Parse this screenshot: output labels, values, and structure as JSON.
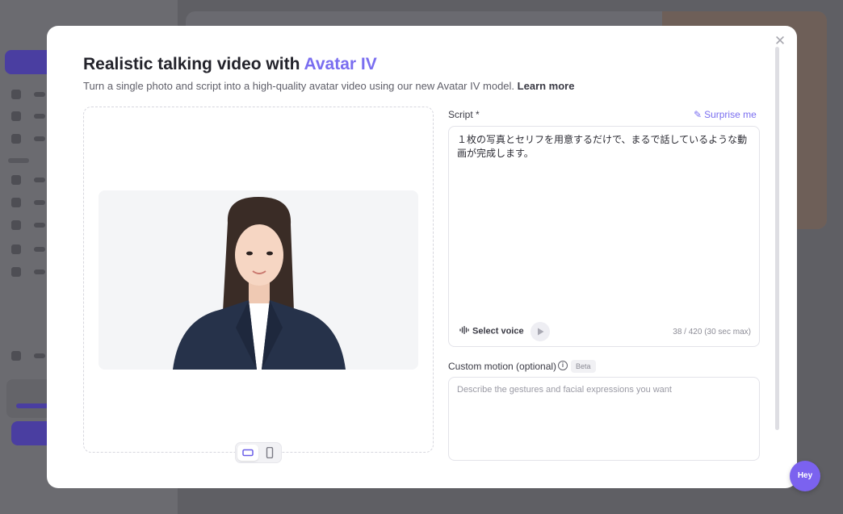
{
  "modal": {
    "title_prefix": "Realistic talking video with ",
    "title_accent": "Avatar IV",
    "subtitle": "Turn a single photo and script into a high-quality avatar video using our new Avatar IV model.",
    "learn_more": "Learn more",
    "close_icon": "close-icon"
  },
  "preview": {
    "photo_alt": "uploaded avatar photo",
    "orientation_selected": "landscape"
  },
  "script": {
    "label": "Script *",
    "surprise_label": "Surprise me",
    "text": "１枚の写真とセリフを用意するだけで、まるで話しているような動画が完成します。",
    "select_voice_label": "Select voice",
    "char_count": "38 / 420 (30 sec max)"
  },
  "motion": {
    "label": "Custom motion (optional)",
    "badge": "Beta",
    "placeholder": "Describe the gestures and facial expressions you want"
  },
  "help": {
    "label": "Hey"
  },
  "colors": {
    "accent": "#7a6ef0",
    "overlay": "#5f5f64",
    "help_button": "#7b62ef"
  }
}
